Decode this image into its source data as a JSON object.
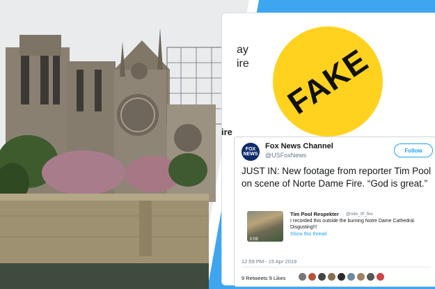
{
  "background_tweet": {
    "text_lines": [
      "ay",
      "ire"
    ],
    "fire_word": "ire"
  },
  "badge": {
    "label": "FAKE",
    "color": "#ffd21f"
  },
  "tweet": {
    "avatar_text": "FOX NEWS",
    "account_name": "Fox News Channel",
    "handle": "@USFoxNews",
    "follow_label": "Follow",
    "body": "JUST IN: New footage from reporter Tim Pool on scene of Norte Dame Fire. “God is great.”",
    "quote": {
      "name": "Tim Pool Respekter",
      "handle": "@nite_0f_fire",
      "text": "I recorded this outside the burning Notre Dame Cathedral. Disgusting!!!",
      "link": "Show this thread",
      "video_time": "0:09"
    },
    "timestamp": "12:59 PM - 15 Apr 2019",
    "stats": "9 Retweets  9 Likes"
  },
  "colors": {
    "sky": "#e7e9ea",
    "accent_blue": "#3ea6f1",
    "stone": "#8c8274"
  }
}
